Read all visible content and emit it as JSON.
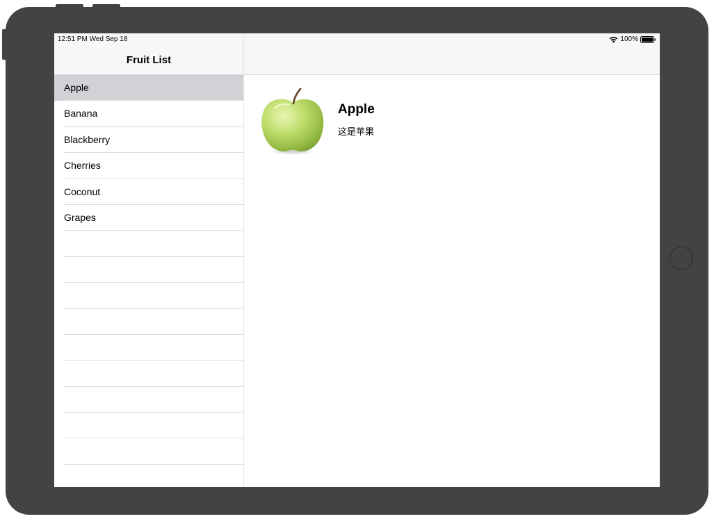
{
  "status_bar": {
    "time_date": "12:51 PM  Wed Sep 18",
    "battery": "100%",
    "wifi_icon": "wifi-icon",
    "battery_icon": "battery-icon"
  },
  "master": {
    "title": "Fruit List",
    "items": [
      {
        "label": "Apple",
        "selected": true
      },
      {
        "label": "Banana",
        "selected": false
      },
      {
        "label": "Blackberry",
        "selected": false
      },
      {
        "label": "Cherries",
        "selected": false
      },
      {
        "label": "Coconut",
        "selected": false
      },
      {
        "label": "Grapes",
        "selected": false
      }
    ],
    "empty_rows": 10
  },
  "detail": {
    "image_icon": "apple-icon",
    "name": "Apple",
    "description": "这是苹果"
  },
  "colors": {
    "device_frame": "#434343",
    "selected_row": "#d1d1d6",
    "nav_bar": "#f7f7f7",
    "separator": "#dcdce0"
  }
}
